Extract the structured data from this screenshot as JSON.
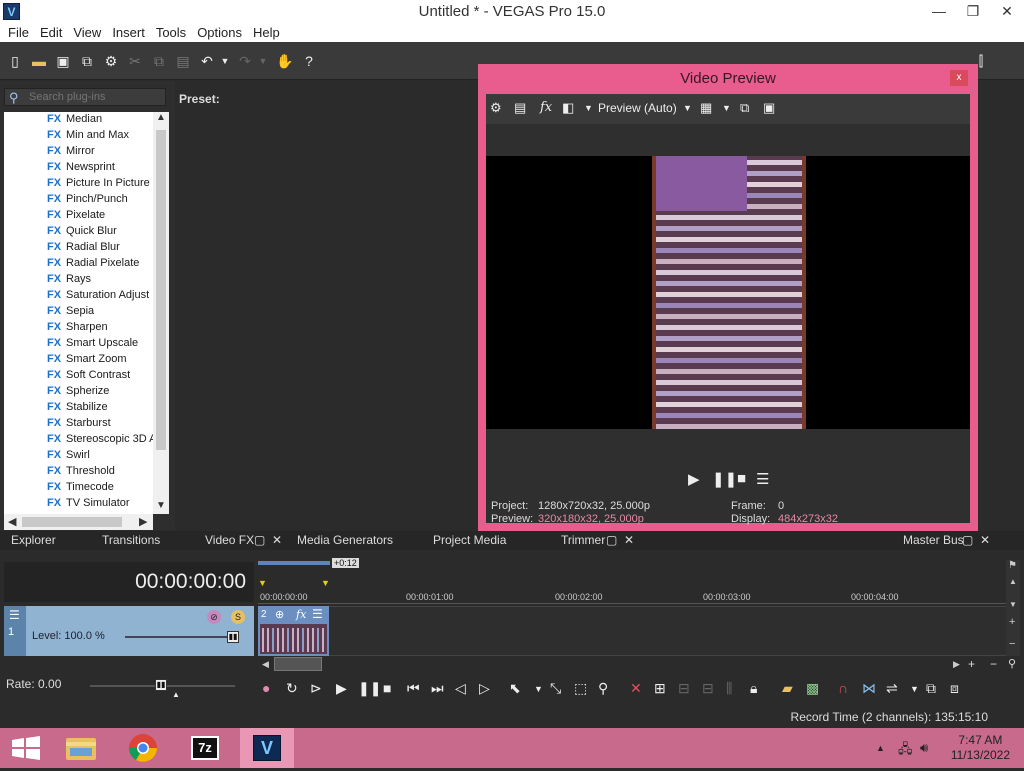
{
  "window": {
    "title": "Untitled * - VEGAS Pro 15.0",
    "app_icon": "V"
  },
  "menu": [
    "File",
    "Edit",
    "View",
    "Insert",
    "Tools",
    "Options",
    "Help"
  ],
  "plugins": {
    "search_placeholder": "Search plug-ins",
    "preset_label": "Preset:",
    "fx_tag": "FX",
    "items": [
      "Median",
      "Min and Max",
      "Mirror",
      "Newsprint",
      "Picture In Picture",
      "Pinch/Punch",
      "Pixelate",
      "Quick Blur",
      "Radial Blur",
      "Radial Pixelate",
      "Rays",
      "Saturation Adjust",
      "Sepia",
      "Sharpen",
      "Smart Upscale",
      "Smart Zoom",
      "Soft Contrast",
      "Spherize",
      "Stabilize",
      "Starburst",
      "Stereoscopic 3D A",
      "Swirl",
      "Threshold",
      "Timecode",
      "TV Simulator"
    ]
  },
  "tabs": {
    "explorer": "Explorer",
    "transitions": "Transitions",
    "video_fx": "Video FX",
    "media_generators": "Media Generators",
    "project_media": "Project Media",
    "trimmer": "Trimmer",
    "master_bus": "Master Bus"
  },
  "video_preview": {
    "title": "Video Preview",
    "close": "x",
    "preview_mode": "Preview (Auto)",
    "project_label": "Project:",
    "project_value": "1280x720x32, 25.000p",
    "preview_label": "Preview:",
    "preview_value": "320x180x32, 25.000p",
    "frame_label": "Frame:",
    "frame_value": "0",
    "display_label": "Display:",
    "display_value": "484x273x32"
  },
  "timeline": {
    "timecode": "00:00:00:00",
    "loop_marker": "+0:12",
    "track_number": "1",
    "level": "Level: 100.0 %",
    "clip_number": "2",
    "ruler": [
      "00:00:00:00",
      "00:00:01:00",
      "00:00:02:00",
      "00:00:03:00",
      "00:00:04:00"
    ],
    "rate": "Rate: 0.00"
  },
  "status": {
    "record_time": "Record Time (2 channels): 135:15:10"
  },
  "taskbar": {
    "time": "7:47 AM",
    "date": "11/13/2022",
    "sevenzip_label": "7z",
    "vegas_label": "V"
  },
  "colors": {
    "preview_frame": "#e85c8e",
    "taskbar": "#c76a8c",
    "fx_tag": "#1f6fd0",
    "track_header": "#8fb3d0"
  }
}
